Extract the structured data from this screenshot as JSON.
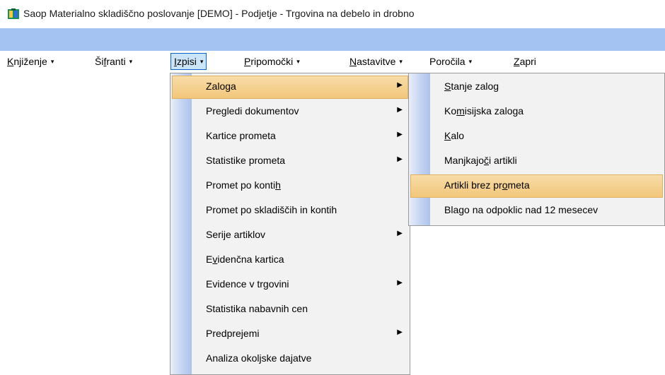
{
  "window": {
    "title": "Saop  Materialno skladiščno poslovanje [DEMO] - Podjetje - Trgovina na debelo in drobno",
    "icon": "app-icon"
  },
  "colors": {
    "menu_band": "#a4c3f2",
    "highlight": "#f2c77a",
    "open_menu_border": "#0a64c8"
  },
  "menubar": {
    "items": [
      {
        "pre": "",
        "u": "K",
        "post": "njiženje",
        "caret": "▾"
      },
      {
        "pre": "Ši",
        "u": "f",
        "post": "ranti",
        "caret": "▾"
      },
      {
        "pre": "",
        "u": "I",
        "post": "zpisi",
        "caret": "▾"
      },
      {
        "pre": "",
        "u": "P",
        "post": "ripomočki",
        "caret": "▾"
      },
      {
        "pre": "",
        "u": "N",
        "post": "astavitve",
        "caret": "▾"
      },
      {
        "pre": "Poročila",
        "u": "",
        "post": "",
        "caret": "▾"
      },
      {
        "pre": "",
        "u": "Z",
        "post": "apri",
        "caret": ""
      }
    ]
  },
  "izpisi_menu": {
    "items": [
      {
        "pre": "Zaloga",
        "u": "",
        "post": "",
        "submenu": true
      },
      {
        "pre": "Pregledi dokumentov",
        "u": "",
        "post": "",
        "submenu": true
      },
      {
        "pre": "Kartice prometa",
        "u": "",
        "post": "",
        "submenu": true
      },
      {
        "pre": "Statistike prometa",
        "u": "",
        "post": "",
        "submenu": true
      },
      {
        "pre": "Promet po konti",
        "u": "h",
        "post": "",
        "submenu": false
      },
      {
        "pre": "Promet po skladiščih in kontih",
        "u": "",
        "post": "",
        "submenu": false
      },
      {
        "pre": "Serije artiklov",
        "u": "",
        "post": "",
        "submenu": true
      },
      {
        "pre": "E",
        "u": "v",
        "post": "idenčna kartica",
        "submenu": false
      },
      {
        "pre": "Evidence v trgovini",
        "u": "",
        "post": "",
        "submenu": true
      },
      {
        "pre": "Statistika nabavnih cen",
        "u": "",
        "post": "",
        "submenu": false
      },
      {
        "pre": "Predprejemi",
        "u": "",
        "post": "",
        "submenu": true
      },
      {
        "pre": "Analiza okoljske dajatve",
        "u": "",
        "post": "",
        "submenu": false
      }
    ]
  },
  "zaloga_submenu": {
    "items": [
      {
        "pre": "",
        "u": "S",
        "post": "tanje zalog"
      },
      {
        "pre": "Ko",
        "u": "m",
        "post": "isijska zaloga"
      },
      {
        "pre": "",
        "u": "K",
        "post": "alo"
      },
      {
        "pre": "Manjkajo",
        "u": "č",
        "post": "i artikli"
      },
      {
        "pre": "Artikli brez pr",
        "u": "o",
        "post": "meta"
      },
      {
        "pre": "Blago na odpoklic nad 12 mesecev",
        "u": "",
        "post": ""
      }
    ]
  },
  "submenu_arrow": "▶"
}
